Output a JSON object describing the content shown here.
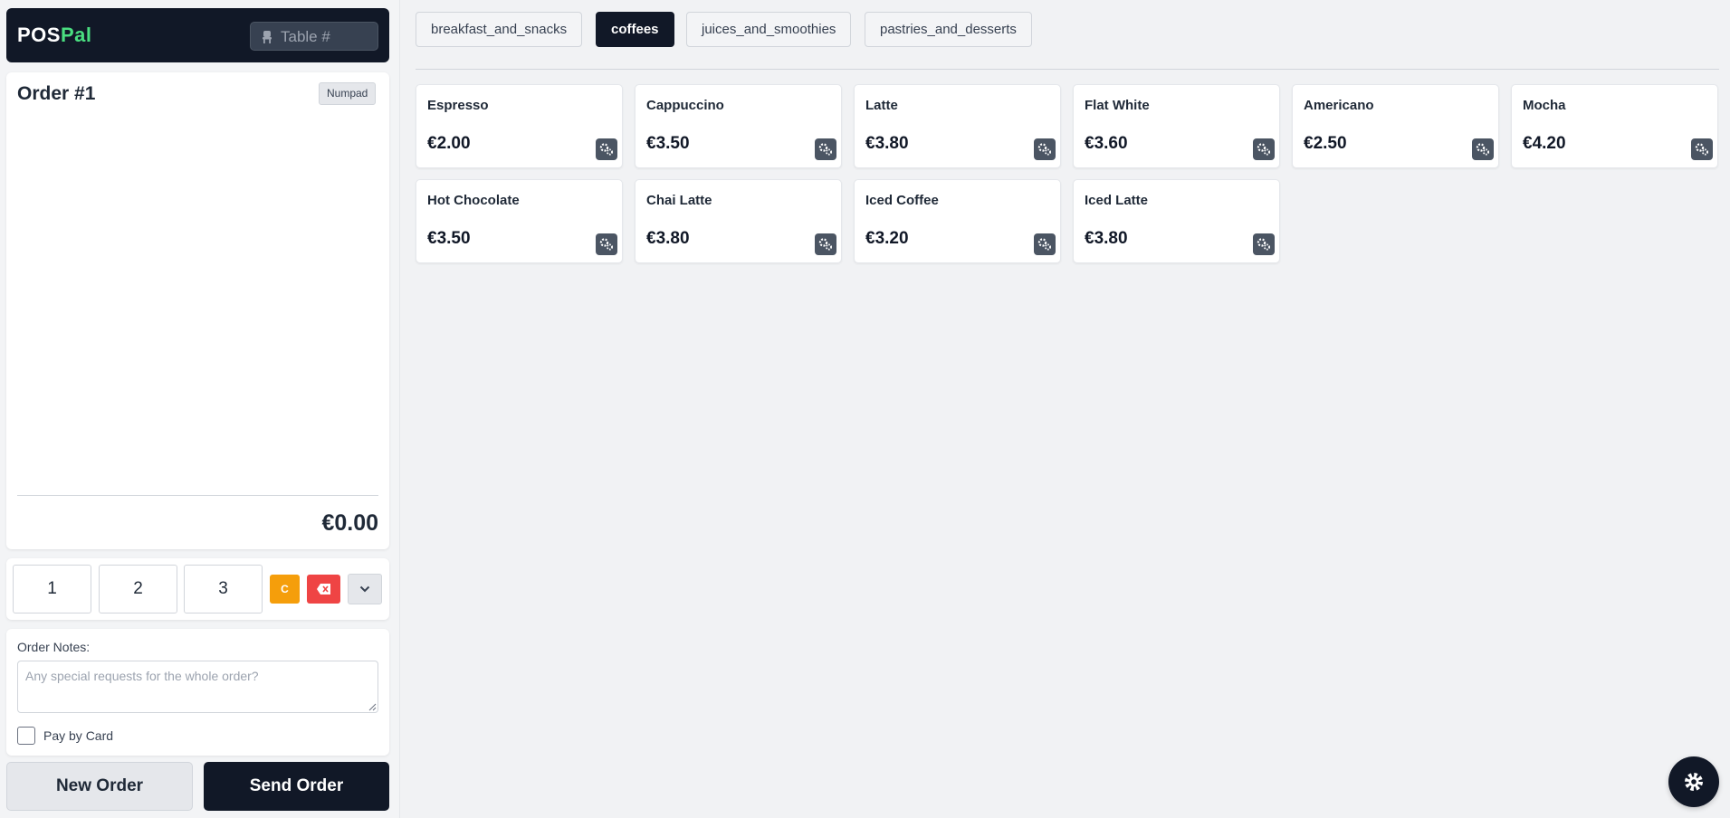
{
  "brand": {
    "part1": "POS",
    "part2": "Pal"
  },
  "table_input": {
    "placeholder": "Table #",
    "value": ""
  },
  "order": {
    "title": "Order #1",
    "numpad_toggle_label": "Numpad",
    "total": "€0.00"
  },
  "keypad": {
    "keys": [
      "1",
      "2",
      "3"
    ],
    "clear_label": "C"
  },
  "notes": {
    "label": "Order Notes:",
    "placeholder": "Any special requests for the whole order?",
    "value": ""
  },
  "payment": {
    "card_label": "Pay by Card",
    "card_checked": false
  },
  "actions": {
    "new_order": "New Order",
    "send_order": "Send Order"
  },
  "categories": [
    {
      "label": "breakfast_and_snacks",
      "active": false
    },
    {
      "label": "coffees",
      "active": true
    },
    {
      "label": "juices_and_smoothies",
      "active": false
    },
    {
      "label": "pastries_and_desserts",
      "active": false
    }
  ],
  "products": [
    {
      "name": "Espresso",
      "price": "€2.00"
    },
    {
      "name": "Cappuccino",
      "price": "€3.50"
    },
    {
      "name": "Latte",
      "price": "€3.80"
    },
    {
      "name": "Flat White",
      "price": "€3.60"
    },
    {
      "name": "Americano",
      "price": "€2.50"
    },
    {
      "name": "Mocha",
      "price": "€4.20"
    },
    {
      "name": "Hot Chocolate",
      "price": "€3.50"
    },
    {
      "name": "Chai Latte",
      "price": "€3.80"
    },
    {
      "name": "Iced Coffee",
      "price": "€3.20"
    },
    {
      "name": "Iced Latte",
      "price": "€3.80"
    }
  ],
  "icons": {
    "table": "chair-icon",
    "backspace": "backspace-icon",
    "collapse": "chevron-down-icon",
    "product_options": "gears-icon",
    "settings": "gear-icon"
  },
  "colors": {
    "brand_dark": "#111827",
    "brand_accent": "#4ade80",
    "clear_key": "#f59e0b",
    "backspace_key": "#ef4444"
  }
}
